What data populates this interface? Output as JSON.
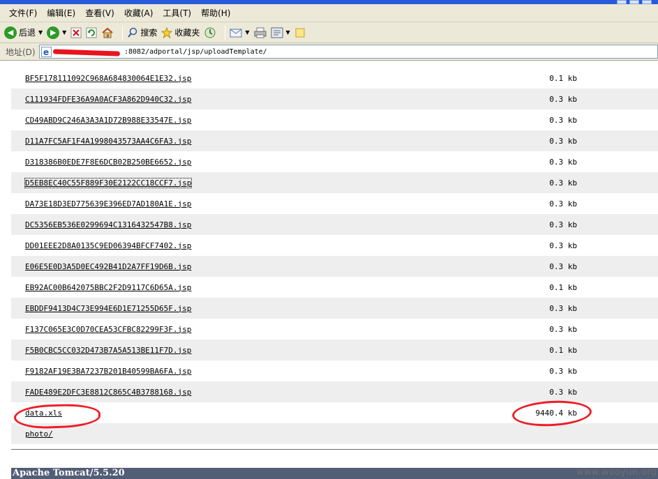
{
  "menubar": {
    "items": [
      "文件(F)",
      "编辑(E)",
      "查看(V)",
      "收藏(A)",
      "工具(T)",
      "帮助(H)"
    ]
  },
  "toolbar": {
    "back_label": "后退",
    "search_label": "搜索",
    "favorites_label": "收藏夹",
    "icons": [
      "back-icon",
      "forward-icon",
      "stop-icon",
      "refresh-icon",
      "home-icon",
      "search-icon",
      "favorites-icon",
      "history-icon",
      "mail-icon",
      "print-icon",
      "edit-icon",
      "folder-icon"
    ]
  },
  "address": {
    "label": "地址(D)",
    "url_visible": ":8082/adportal/jsp/uploadTemplate/"
  },
  "files": [
    {
      "name": "BF5F178111092C968A684830064E1E32.jsp",
      "size": "0.1 kb"
    },
    {
      "name": "C111934FDFE36A9A0ACF3A862D940C32.jsp",
      "size": "0.3 kb"
    },
    {
      "name": "CD49ABD9C246A3A3A1D72B988E33547E.jsp",
      "size": "0.3 kb"
    },
    {
      "name": "D11A7FC5AF1F4A1998043573AA4C6FA3.jsp",
      "size": "0.3 kb"
    },
    {
      "name": "D318386B0EDE7F8E6DCB02B250BE6652.jsp",
      "size": "0.3 kb"
    },
    {
      "name": "D5EB8EC40C55F889F30E2122CC18CCF7.jsp",
      "size": "0.3 kb"
    },
    {
      "name": "DA73E18D3ED775639E396ED7AD180A1E.jsp",
      "size": "0.3 kb"
    },
    {
      "name": "DC5356EB536E0299694C1316432547B8.jsp",
      "size": "0.3 kb"
    },
    {
      "name": "DD01EEE2D8A0135C9ED06394BFCF7402.jsp",
      "size": "0.3 kb"
    },
    {
      "name": "E06E5E0D3A5D0EC492B41D2A7FF19D6B.jsp",
      "size": "0.3 kb"
    },
    {
      "name": "EB92AC00B642075BBC2F2D9117C6D65A.jsp",
      "size": "0.1 kb"
    },
    {
      "name": "EBDDF9413D4C73E994E6D1E71255D65F.jsp",
      "size": "0.3 kb"
    },
    {
      "name": "F137C065E3C0D70CEA53CFBC82299F3F.jsp",
      "size": "0.3 kb"
    },
    {
      "name": "F5B0CBC5CC032D473B7A5A513BE11F7D.jsp",
      "size": "0.1 kb"
    },
    {
      "name": "F9182AF19E3BA7237B201B40599BA6FA.jsp",
      "size": "0.3 kb"
    },
    {
      "name": "FADE489E2DFC3E8812C865C4B3788168.jsp",
      "size": "0.3 kb"
    },
    {
      "name": "data.xls",
      "size": "9440.4 kb"
    },
    {
      "name": "photo/",
      "size": ""
    }
  ],
  "footer": {
    "server": "Apache Tomcat/5.5.20"
  },
  "watermark": "www.wooyun.org",
  "colors": {
    "annotation": "#ee1c25",
    "footer_bg": "#525d76",
    "row_shade": "#eeeeee"
  }
}
